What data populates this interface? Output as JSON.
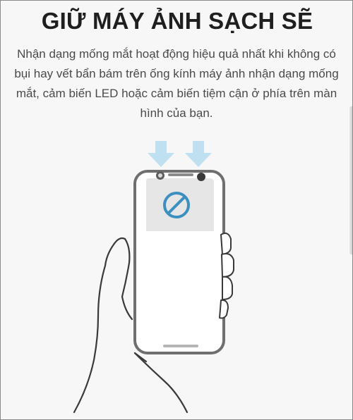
{
  "title": "GIỮ MÁY ẢNH SẠCH SẼ",
  "description": "Nhận dạng mống mắt hoạt động hiệu quả nhất khi không có bụi hay vết bẩn bám trên ống kính máy ảnh nhận dạng mống mắt, cảm biến LED hoặc cảm biến tiệm cận ở phía trên màn hình của bạn.",
  "colors": {
    "accent": "#3c8fbf",
    "arrow": "#bfe0f1",
    "screen_top": "#e6e6e6",
    "screen_bottom": "#ffffff",
    "phone_border": "#7a7a7a"
  },
  "icons": [
    "down-arrow-icon",
    "no-entry-icon"
  ]
}
